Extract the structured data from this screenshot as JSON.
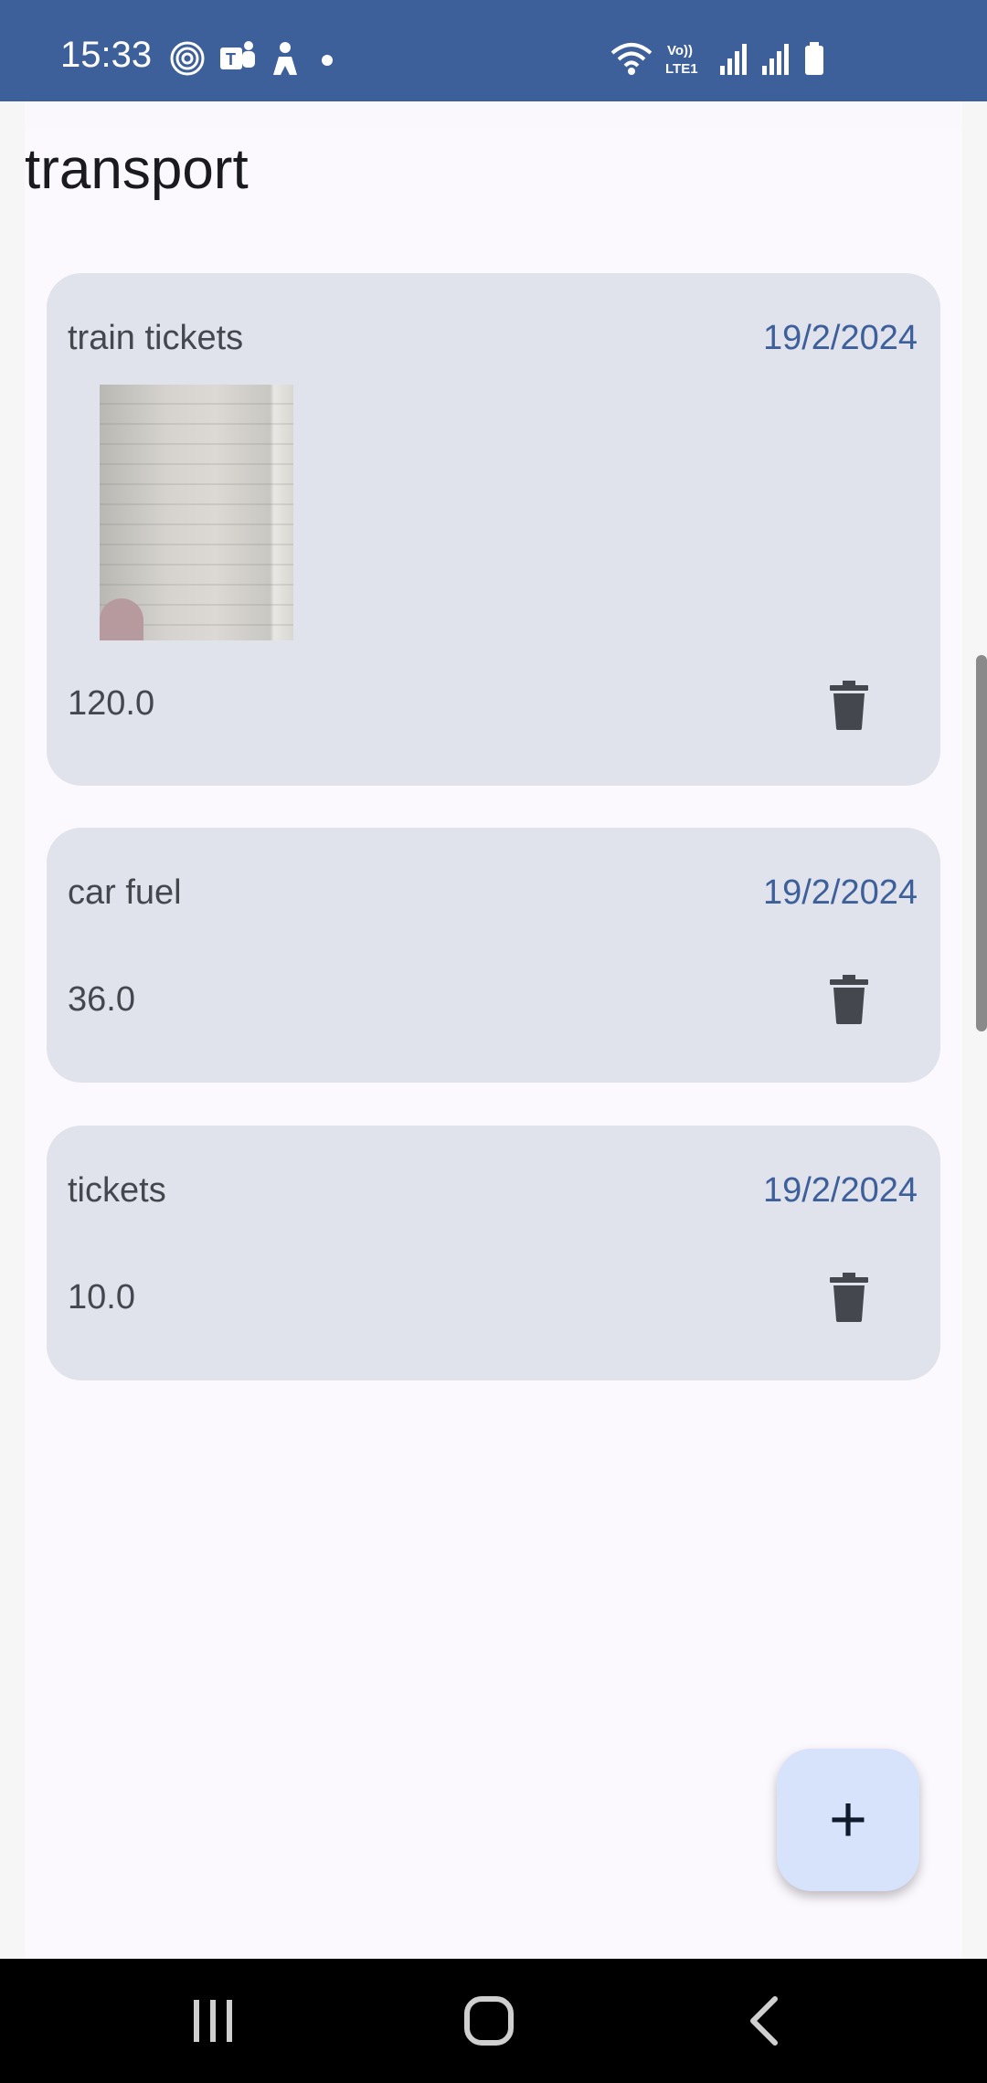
{
  "status_bar": {
    "time": "15:33",
    "left_icons": [
      "fingerprint-icon",
      "teams-icon",
      "person-icon",
      "dot-icon"
    ],
    "right_icons": [
      "wifi-icon",
      "volte-icon",
      "signal-icon",
      "signal-icon",
      "battery-icon"
    ],
    "volte_label": "Vo)) LTE1"
  },
  "page": {
    "title": "transport"
  },
  "expenses": [
    {
      "name": "train tickets",
      "date": "19/2/2024",
      "amount": "120.0",
      "has_image": true
    },
    {
      "name": "car fuel",
      "date": "19/2/2024",
      "amount": "36.0",
      "has_image": false
    },
    {
      "name": "tickets",
      "date": "19/2/2024",
      "amount": "10.0",
      "has_image": false
    }
  ],
  "fab": {
    "label": "+"
  },
  "colors": {
    "status_bar": "#3d5f9a",
    "accent_date": "#3d5f9a",
    "card_bg": "#e0e2ec",
    "fab_bg": "#d7e3fb"
  },
  "nav_bar": {
    "buttons": [
      "recents-icon",
      "home-icon",
      "back-icon"
    ]
  }
}
